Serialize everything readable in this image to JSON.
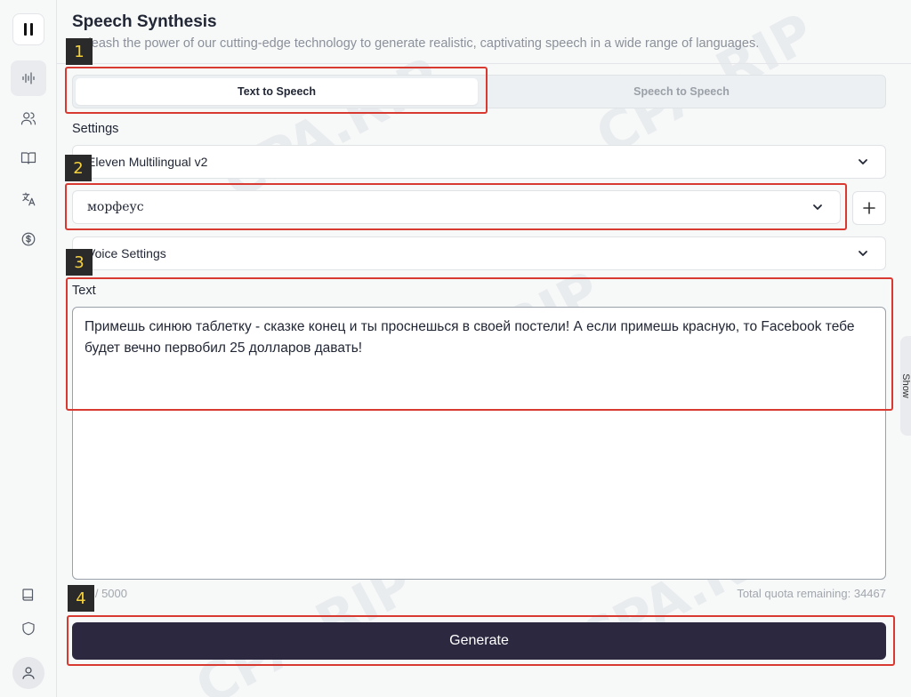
{
  "header": {
    "title": "Speech Synthesis",
    "subtitle": "Unleash the power of our cutting-edge technology to generate realistic, captivating speech in a wide range of languages."
  },
  "tabs": [
    {
      "label": "Text to Speech",
      "active": true
    },
    {
      "label": "Speech to Speech",
      "active": false
    }
  ],
  "settings": {
    "label": "Settings",
    "model": "Eleven Multilingual v2",
    "voice": "морфеус",
    "voice_settings": "Voice Settings"
  },
  "text_section": {
    "label": "Text",
    "value": "Примешь синюю таблетку - сказке конец и ты проснешься в своей постели! А если примешь красную, то Facebook тебе будет вечно первобил 25 долларов давать!",
    "char_count": "0 / 5000",
    "quota": "Total quota remaining: 34467"
  },
  "actions": {
    "generate": "Generate",
    "show": "Show"
  },
  "annotations": [
    "1",
    "2",
    "3",
    "4"
  ],
  "watermark": "CPA.RIP",
  "colors": {
    "accent": "#2b2840",
    "annotation_red": "#d83a32",
    "annotation_label_bg": "#2a2a2a",
    "annotation_label_text": "#f5d13c"
  }
}
